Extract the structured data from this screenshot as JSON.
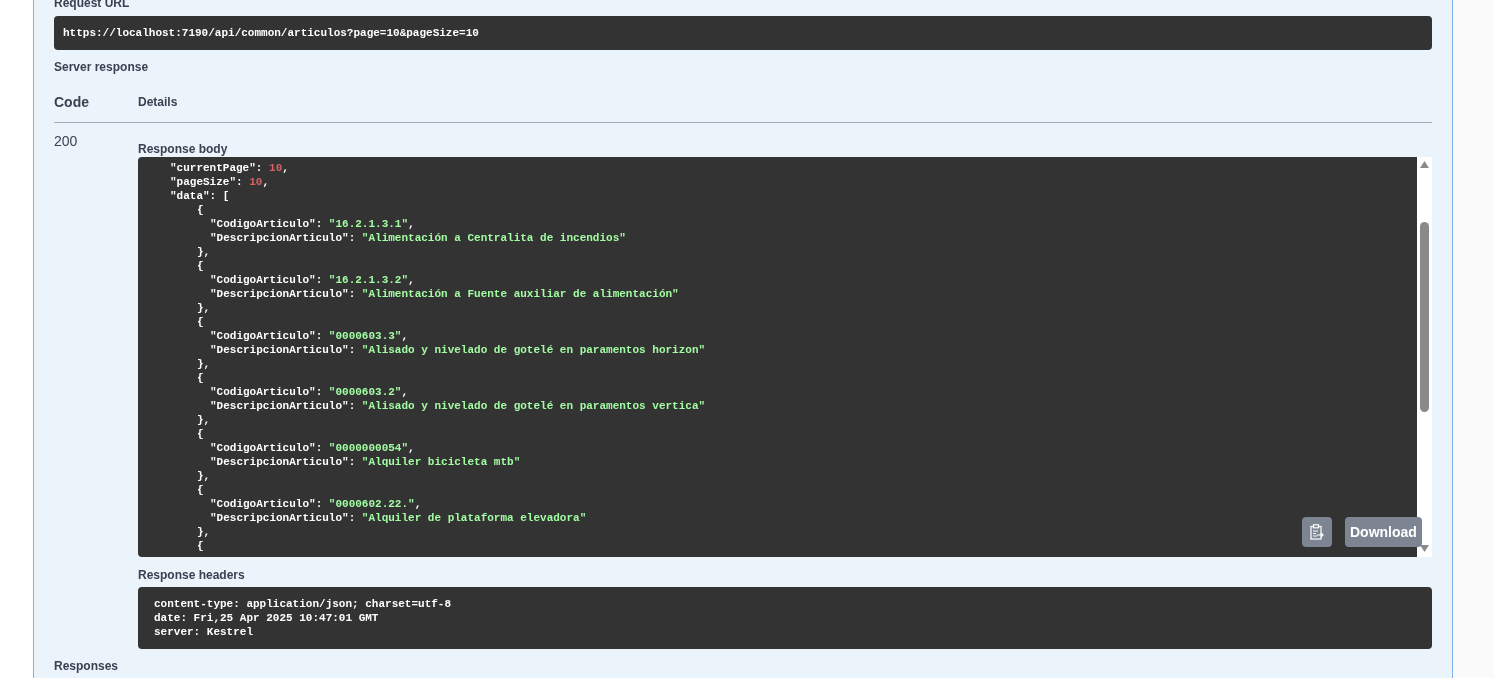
{
  "request_url": {
    "label": "Request URL",
    "value": "https://localhost:7190/api/common/articulos?page=10&pageSize=10"
  },
  "server_response": {
    "label": "Server response",
    "columns": [
      "Code",
      "Details"
    ],
    "code": "200",
    "response_body": {
      "label": "Response body",
      "download_label": "Download",
      "lines": [
        {
          "kind": "top",
          "tokens": [
            {
              "kind": "key",
              "text": "\"currentPage\""
            },
            {
              "kind": "punct",
              "text": ": "
            },
            {
              "kind": "number",
              "text": "10"
            },
            {
              "kind": "punct",
              "text": ","
            }
          ]
        },
        {
          "kind": "top",
          "tokens": [
            {
              "kind": "key",
              "text": "\"pageSize\""
            },
            {
              "kind": "punct",
              "text": ": "
            },
            {
              "kind": "number",
              "text": "10"
            },
            {
              "kind": "punct",
              "text": ","
            }
          ]
        },
        {
          "kind": "top",
          "tokens": [
            {
              "kind": "key",
              "text": "\"data\""
            },
            {
              "kind": "punct",
              "text": ": ["
            }
          ]
        },
        {
          "kind": "brace",
          "tokens": [
            {
              "kind": "punct",
              "text": "{"
            }
          ]
        },
        {
          "kind": "field",
          "tokens": [
            {
              "kind": "key",
              "text": "\"CodigoArticulo\""
            },
            {
              "kind": "punct",
              "text": ": "
            },
            {
              "kind": "string",
              "text": "\"16.2.1.3.1\""
            },
            {
              "kind": "punct",
              "text": ","
            }
          ]
        },
        {
          "kind": "field",
          "tokens": [
            {
              "kind": "key",
              "text": "\"DescripcionArticulo\""
            },
            {
              "kind": "punct",
              "text": ": "
            },
            {
              "kind": "string",
              "text": "\"Alimentación a Centralita de incendios\""
            }
          ]
        },
        {
          "kind": "brace",
          "tokens": [
            {
              "kind": "punct",
              "text": "},"
            }
          ]
        },
        {
          "kind": "brace",
          "tokens": [
            {
              "kind": "punct",
              "text": "{"
            }
          ]
        },
        {
          "kind": "field",
          "tokens": [
            {
              "kind": "key",
              "text": "\"CodigoArticulo\""
            },
            {
              "kind": "punct",
              "text": ": "
            },
            {
              "kind": "string",
              "text": "\"16.2.1.3.2\""
            },
            {
              "kind": "punct",
              "text": ","
            }
          ]
        },
        {
          "kind": "field",
          "tokens": [
            {
              "kind": "key",
              "text": "\"DescripcionArticulo\""
            },
            {
              "kind": "punct",
              "text": ": "
            },
            {
              "kind": "string",
              "text": "\"Alimentación a Fuente auxiliar de alimentación\""
            }
          ]
        },
        {
          "kind": "brace",
          "tokens": [
            {
              "kind": "punct",
              "text": "},"
            }
          ]
        },
        {
          "kind": "brace",
          "tokens": [
            {
              "kind": "punct",
              "text": "{"
            }
          ]
        },
        {
          "kind": "field",
          "tokens": [
            {
              "kind": "key",
              "text": "\"CodigoArticulo\""
            },
            {
              "kind": "punct",
              "text": ": "
            },
            {
              "kind": "string",
              "text": "\"0000603.3\""
            },
            {
              "kind": "punct",
              "text": ","
            }
          ]
        },
        {
          "kind": "field",
          "tokens": [
            {
              "kind": "key",
              "text": "\"DescripcionArticulo\""
            },
            {
              "kind": "punct",
              "text": ": "
            },
            {
              "kind": "string",
              "text": "\"Alisado y nivelado de gotelé en paramentos horizon\""
            }
          ]
        },
        {
          "kind": "brace",
          "tokens": [
            {
              "kind": "punct",
              "text": "},"
            }
          ]
        },
        {
          "kind": "brace",
          "tokens": [
            {
              "kind": "punct",
              "text": "{"
            }
          ]
        },
        {
          "kind": "field",
          "tokens": [
            {
              "kind": "key",
              "text": "\"CodigoArticulo\""
            },
            {
              "kind": "punct",
              "text": ": "
            },
            {
              "kind": "string",
              "text": "\"0000603.2\""
            },
            {
              "kind": "punct",
              "text": ","
            }
          ]
        },
        {
          "kind": "field",
          "tokens": [
            {
              "kind": "key",
              "text": "\"DescripcionArticulo\""
            },
            {
              "kind": "punct",
              "text": ": "
            },
            {
              "kind": "string",
              "text": "\"Alisado y nivelado de gotelé en paramentos vertica\""
            }
          ]
        },
        {
          "kind": "brace",
          "tokens": [
            {
              "kind": "punct",
              "text": "},"
            }
          ]
        },
        {
          "kind": "brace",
          "tokens": [
            {
              "kind": "punct",
              "text": "{"
            }
          ]
        },
        {
          "kind": "field",
          "tokens": [
            {
              "kind": "key",
              "text": "\"CodigoArticulo\""
            },
            {
              "kind": "punct",
              "text": ": "
            },
            {
              "kind": "string",
              "text": "\"0000000054\""
            },
            {
              "kind": "punct",
              "text": ","
            }
          ]
        },
        {
          "kind": "field",
          "tokens": [
            {
              "kind": "key",
              "text": "\"DescripcionArticulo\""
            },
            {
              "kind": "punct",
              "text": ": "
            },
            {
              "kind": "string",
              "text": "\"Alquiler bicicleta mtb\""
            }
          ]
        },
        {
          "kind": "brace",
          "tokens": [
            {
              "kind": "punct",
              "text": "},"
            }
          ]
        },
        {
          "kind": "brace",
          "tokens": [
            {
              "kind": "punct",
              "text": "{"
            }
          ]
        },
        {
          "kind": "field",
          "tokens": [
            {
              "kind": "key",
              "text": "\"CodigoArticulo\""
            },
            {
              "kind": "punct",
              "text": ": "
            },
            {
              "kind": "string",
              "text": "\"0000602.22.\""
            },
            {
              "kind": "punct",
              "text": ","
            }
          ]
        },
        {
          "kind": "field",
          "tokens": [
            {
              "kind": "key",
              "text": "\"DescripcionArticulo\""
            },
            {
              "kind": "punct",
              "text": ": "
            },
            {
              "kind": "string",
              "text": "\"Alquiler de plataforma elevadora\""
            }
          ]
        },
        {
          "kind": "brace",
          "tokens": [
            {
              "kind": "punct",
              "text": "},"
            }
          ]
        },
        {
          "kind": "brace",
          "tokens": [
            {
              "kind": "punct",
              "text": "{"
            }
          ]
        }
      ]
    },
    "response_headers": {
      "label": "Response headers",
      "lines": [
        "content-type: application/json; charset=utf-8",
        "date: Fri,25 Apr 2025 10:47:01 GMT",
        "server: Kestrel"
      ]
    }
  },
  "responses": {
    "label": "Responses"
  }
}
